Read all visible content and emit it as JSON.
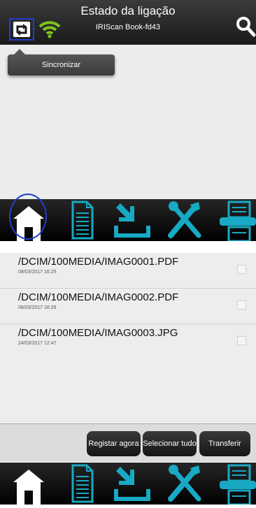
{
  "header": {
    "title": "Estado da ligação",
    "device": "IRIScan Book-fd43",
    "sync_icon": "sync-icon",
    "wifi_icon": "wifi-icon",
    "search_icon": "search-icon"
  },
  "tooltip": {
    "label": "Sincronizar"
  },
  "nav": {
    "items": [
      {
        "icon": "home-icon"
      },
      {
        "icon": "document-icon"
      },
      {
        "icon": "download-icon"
      },
      {
        "icon": "tools-icon"
      },
      {
        "icon": "printer-icon"
      }
    ],
    "accent": "#18a9c4"
  },
  "files": [
    {
      "name": "/DCIM/100MEDIA/IMAG0001.PDF",
      "date": "08/03/2017 16:25"
    },
    {
      "name": "/DCIM/100MEDIA/IMAG0002.PDF",
      "date": "08/03/2017 16:26"
    },
    {
      "name": "/DCIM/100MEDIA/IMAG0003.JPG",
      "date": "24/03/2017 12:47"
    }
  ],
  "actions": {
    "register": "Registar agora",
    "select_all": "Selecionar tudo",
    "transfer": "Transferir"
  }
}
